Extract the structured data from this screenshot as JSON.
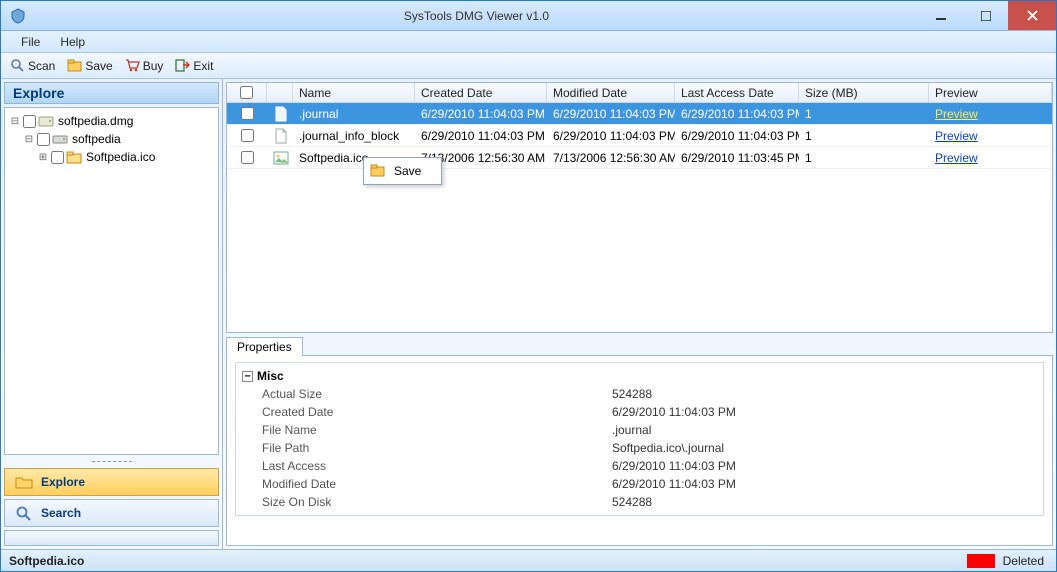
{
  "window": {
    "title": "SysTools DMG Viewer v1.0"
  },
  "menu": {
    "file": "File",
    "help": "Help"
  },
  "toolbar": {
    "scan": "Scan",
    "save": "Save",
    "buy": "Buy",
    "exit": "Exit"
  },
  "sidebar": {
    "header": "Explore",
    "tree": [
      {
        "label": "softpedia.dmg"
      },
      {
        "label": "softpedia"
      },
      {
        "label": "Softpedia.ico"
      }
    ],
    "nav": {
      "explore": "Explore",
      "search": "Search"
    }
  },
  "list": {
    "headers": {
      "name": "Name",
      "created": "Created Date",
      "modified": "Modified Date",
      "access": "Last Access Date",
      "size": "Size (MB)",
      "preview": "Preview"
    },
    "rows": [
      {
        "name": ".journal",
        "created": "6/29/2010 11:04:03 PM",
        "modified": "6/29/2010 11:04:03 PM",
        "access": "6/29/2010 11:04:03 PM",
        "size": "1",
        "preview": "Preview",
        "selected": true,
        "icon": "file"
      },
      {
        "name": ".journal_info_block",
        "created": "6/29/2010 11:04:03 PM",
        "modified": "6/29/2010 11:04:03 PM",
        "access": "6/29/2010 11:04:03 PM",
        "size": "1",
        "preview": "Preview",
        "selected": false,
        "icon": "file"
      },
      {
        "name": "Softpedia.ico",
        "created": "7/13/2006 12:56:30 AM",
        "modified": "7/13/2006 12:56:30 AM",
        "access": "6/29/2010 11:03:45 PM",
        "size": "1",
        "preview": "Preview",
        "selected": false,
        "icon": "image"
      }
    ]
  },
  "context_menu": {
    "save": "Save"
  },
  "properties": {
    "tab": "Properties",
    "group": "Misc",
    "rows": [
      {
        "k": "Actual Size",
        "v": "524288"
      },
      {
        "k": "Created Date",
        "v": "6/29/2010 11:04:03 PM"
      },
      {
        "k": "File Name",
        "v": ".journal"
      },
      {
        "k": "File Path",
        "v": "Softpedia.ico\\.journal"
      },
      {
        "k": "Last Access",
        "v": "6/29/2010 11:04:03 PM"
      },
      {
        "k": "Modified Date",
        "v": "6/29/2010 11:04:03 PM"
      },
      {
        "k": "Size On Disk",
        "v": "524288"
      }
    ]
  },
  "statusbar": {
    "left": "Softpedia.ico",
    "right": "Deleted",
    "swatch_color": "#ff0000"
  }
}
